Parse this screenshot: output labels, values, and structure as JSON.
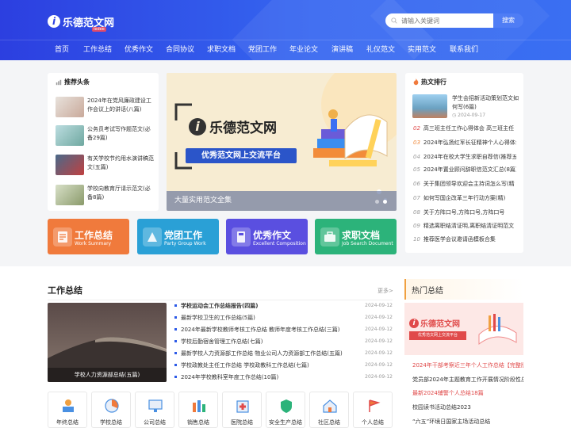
{
  "header": {
    "logo_text": "乐德范文网",
    "logo_tag": "ledee",
    "search_placeholder": "请输入关键词",
    "search_button": "搜索"
  },
  "nav": [
    "首页",
    "工作总结",
    "优秀作文",
    "合同协议",
    "求职文档",
    "党团工作",
    "年业论文",
    "演讲稿",
    "礼仪范文",
    "实用范文",
    "联系我们"
  ],
  "recommend": {
    "title": "推荐头条",
    "items": [
      {
        "text": "2024年在党风廉政建设工作会议上的讲话(八篇)"
      },
      {
        "text": "公务员考试写作题范文(必备29篇)"
      },
      {
        "text": "有关学校节约用水演讲稿范文(五篇)"
      },
      {
        "text": "学校向教育厅请示范文(必备8篇)"
      }
    ]
  },
  "banner": {
    "logo_text": "乐德范文网",
    "slogan": "优秀范文网上交流平台",
    "caption": "大量实用范文全集"
  },
  "hot": {
    "title": "热文排行",
    "top": {
      "text": "学生会招新活动策划范文如何写(6篇)",
      "date": "2024-09-17"
    },
    "items": [
      {
        "num": "02",
        "text": "高三班主任工作心得体会 高三班主任"
      },
      {
        "num": "03",
        "text": "2024年弘扬红军长征精神个人心得体会"
      },
      {
        "num": "04",
        "text": "2024年在校大学生求职自荐信(推荐五篇)"
      },
      {
        "num": "05",
        "text": "2024年置业顾问辞职信范文汇总(8篇)"
      },
      {
        "num": "06",
        "text": "关于集团领导欢迎会主持词怎么写(精"
      },
      {
        "num": "07",
        "text": "如何写国企改革三年行动方案(精)"
      },
      {
        "num": "08",
        "text": "关于方阵口号,方阵口号,方阵口号"
      },
      {
        "num": "09",
        "text": "精选离职结清证明,离职结清证明范文"
      },
      {
        "num": "10",
        "text": "推荐医学会议邀请函模板合集"
      }
    ]
  },
  "tiles": [
    {
      "title": "工作总结",
      "sub": "Work Summary",
      "color": "#f07a3c"
    },
    {
      "title": "党团工作",
      "sub": "Party Group Work",
      "color": "#2aa0d6"
    },
    {
      "title": "优秀作文",
      "sub": "Excellent Composition",
      "color": "#5a4fe0"
    },
    {
      "title": "求职文档",
      "sub": "Job Search Document",
      "color": "#2cb37a"
    }
  ],
  "work_summary": {
    "title": "工作总结",
    "more": "更多>",
    "image_caption": "学校人力资源部总结(五篇)",
    "items": [
      {
        "text": "学校运动会工作总结报告(四篇)",
        "date": "2024-09-12",
        "bold": true
      },
      {
        "text": "最新学校卫生的工作总结(5篇)",
        "date": "2024-09-12"
      },
      {
        "text": "2024年最新学校教师考核工作总结 教师年度考核工作总结(三篇)",
        "date": "2024-09-12"
      },
      {
        "text": "学校后勤宿舍管理工作总结(七篇)",
        "date": "2024-09-12"
      },
      {
        "text": "最新学校人力资源部工作总结 物业公司人力资源部工作总结(五篇)",
        "date": "2024-09-12"
      },
      {
        "text": "学校政教处主任工作总结 学校政教科工作总结(七篇)",
        "date": "2024-09-12"
      },
      {
        "text": "2024年学校教科室年度工作总结(10篇)",
        "date": "2024-09-12"
      }
    ]
  },
  "categories": [
    {
      "label": "年终总结",
      "icon": "year-end-icon"
    },
    {
      "label": "学校总结",
      "icon": "school-icon"
    },
    {
      "label": "公司总结",
      "icon": "company-icon"
    },
    {
      "label": "销售总结",
      "icon": "sales-icon"
    },
    {
      "label": "医院总结",
      "icon": "hospital-icon"
    },
    {
      "label": "安全生产总结",
      "icon": "safety-icon"
    },
    {
      "label": "社区总结",
      "icon": "community-icon"
    },
    {
      "label": "个人总结",
      "icon": "personal-icon"
    }
  ],
  "hot_side": {
    "title": "热门总结",
    "banner_logo": "乐德范文网",
    "banner_slogan": "优秀范文网上交流平台",
    "items": [
      {
        "text": "2024年干部考察近三年个人工作总结【完整版】",
        "red": true
      },
      {
        "text": "党员部2024年主题教育工作开展情况阶段性总结"
      },
      {
        "text": "最新2024辅警个人总结18篇",
        "red": true
      },
      {
        "text": "校园读书活动总结2023"
      },
      {
        "text": "“六五”环境日国家主场活动总结"
      }
    ]
  }
}
